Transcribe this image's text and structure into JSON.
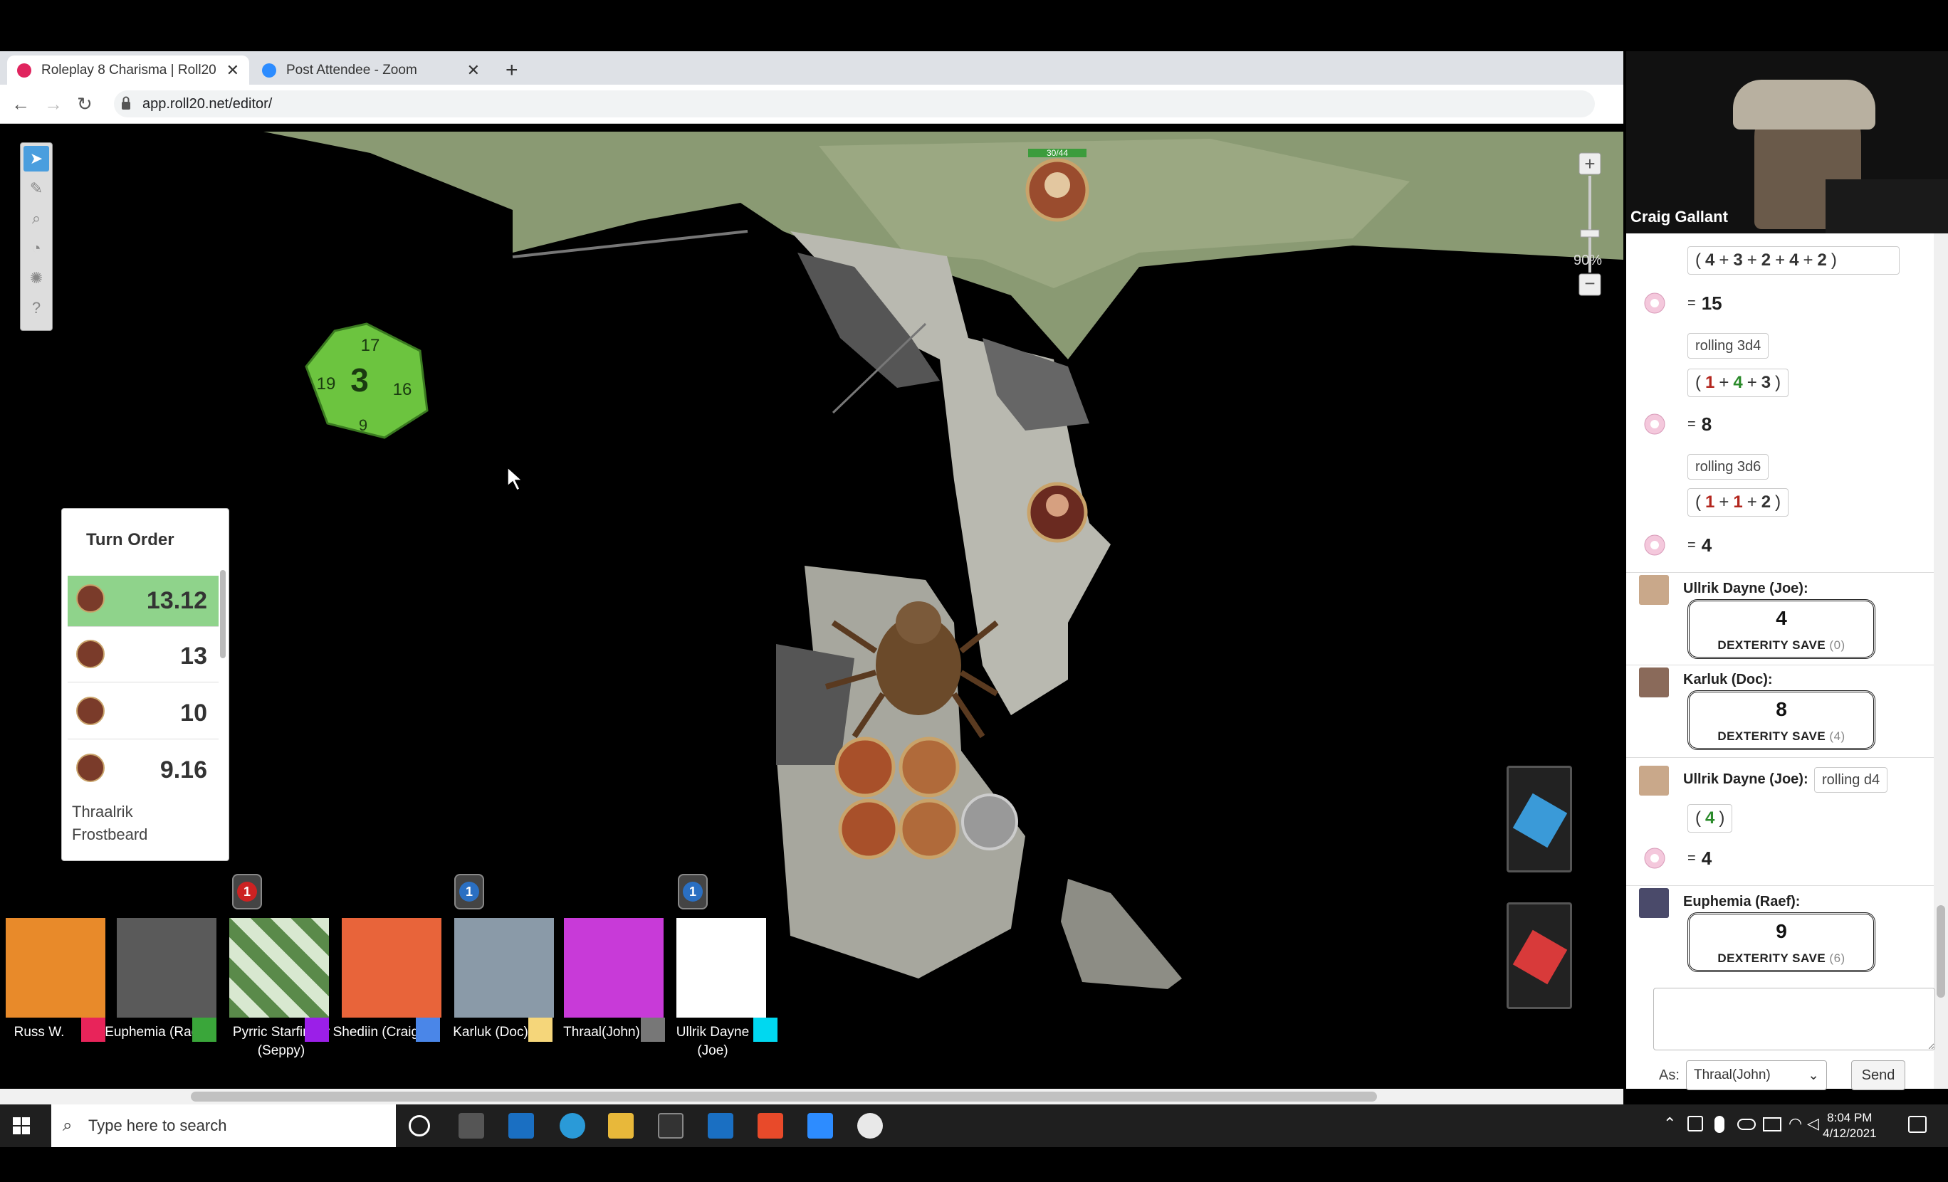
{
  "browser": {
    "tabs": [
      {
        "label": "Roleplay 8 Charisma | Roll20",
        "active": true
      },
      {
        "label": "Post Attendee - Zoom",
        "active": false
      }
    ],
    "url": "app.roll20.net/editor/"
  },
  "map": {
    "zoom_label": "90%",
    "token_hp": "30/44",
    "die_faces": [
      "3",
      "17",
      "19",
      "16",
      "9"
    ]
  },
  "turn_order": {
    "title": "Turn Order",
    "rows": [
      {
        "value": "13.12",
        "current": true
      },
      {
        "value": "13"
      },
      {
        "value": "10"
      },
      {
        "value": "9.16"
      }
    ],
    "last_name": "Thraalrik Frostbeard"
  },
  "players": [
    {
      "name": "Russ W.",
      "color": "#e8245a"
    },
    {
      "name": "Euphemia (Raef)",
      "color": "#3aa63a"
    },
    {
      "name": "Pyrric Starfinder (Seppy)",
      "color": "#9b1fe8"
    },
    {
      "name": "Shediin (Craig)",
      "color": "#4a86e8"
    },
    {
      "name": "Karluk (Doc)",
      "color": "#f5d67a"
    },
    {
      "name": "Thraal(John)",
      "color": "#777777"
    },
    {
      "name": "Ullrik Dayne (Joe)",
      "color": "#00d8f0"
    }
  ],
  "player_badges": [
    "1",
    "1",
    "1"
  ],
  "webcam": {
    "name": "Craig Gallant"
  },
  "chat": {
    "roll1": {
      "dice": [
        "4",
        "3",
        "2",
        "4",
        "2"
      ],
      "total": "15"
    },
    "roll2": {
      "label": "rolling 3d4",
      "dice": [
        "1",
        "4",
        "3"
      ],
      "total": "8"
    },
    "roll3": {
      "label": "rolling 3d6",
      "dice": [
        "1",
        "1",
        "2"
      ],
      "total": "4"
    },
    "save1": {
      "who": "Ullrik Dayne (Joe):",
      "value": "4",
      "title": "DEXTERITY SAVE",
      "mod": "(0)"
    },
    "save2": {
      "who": "Karluk (Doc):",
      "value": "8",
      "title": "DEXTERITY SAVE",
      "mod": "(4)"
    },
    "roll4": {
      "who": "Ullrik Dayne (Joe):",
      "label": "rolling d4",
      "dice": [
        "4"
      ],
      "total": "4"
    },
    "save3": {
      "who": "Euphemia (Raef):",
      "value": "9",
      "title": "DEXTERITY SAVE",
      "mod": "(6)"
    },
    "eq": "=",
    "as_label": "As:",
    "as_value": "Thraal(John)",
    "send": "Send"
  },
  "taskbar": {
    "search_placeholder": "Type here to search",
    "time": "8:04 PM",
    "date": "4/12/2021"
  }
}
